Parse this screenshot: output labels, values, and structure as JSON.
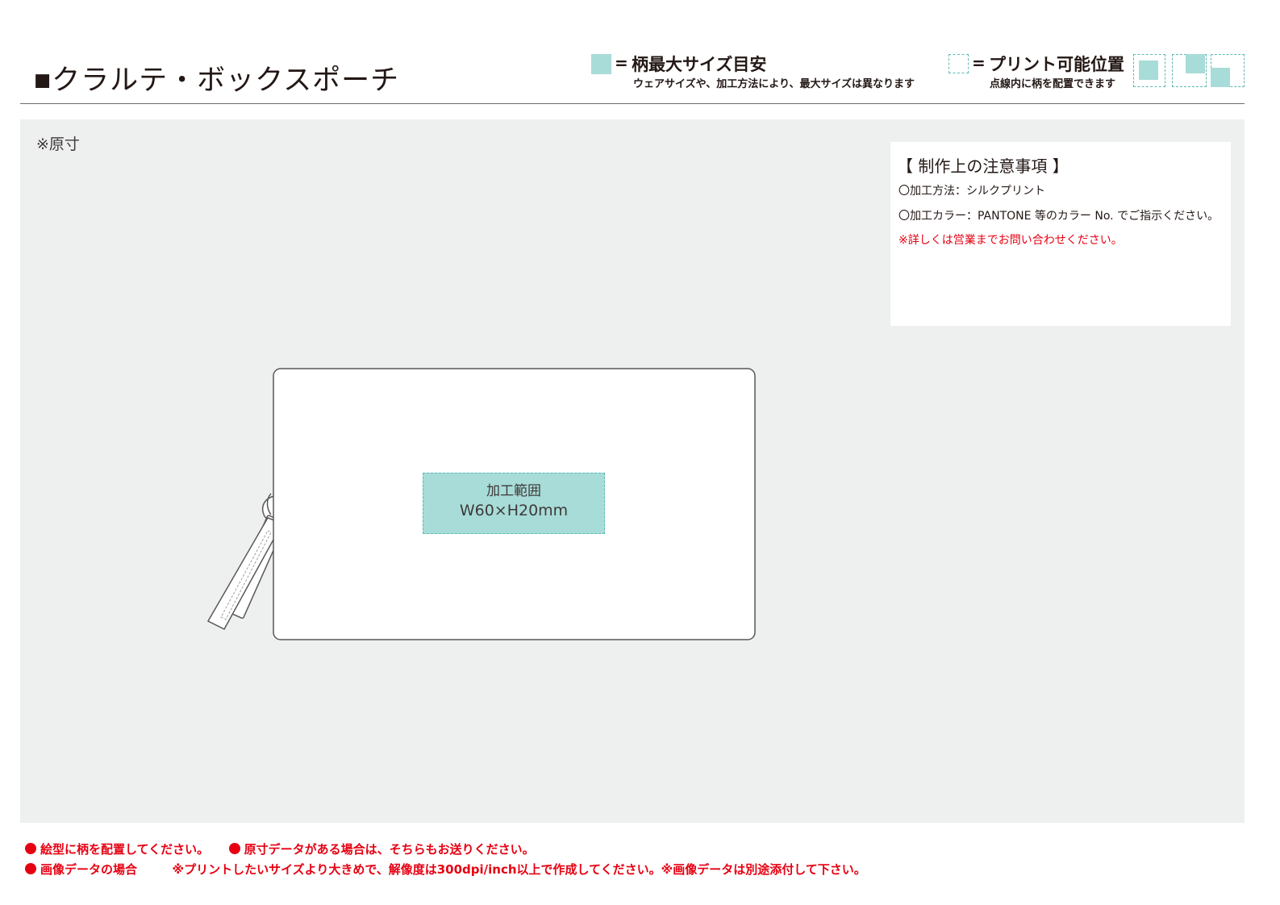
{
  "header": {
    "title": "■クラルテ・ボックスポーチ",
    "legend_max": {
      "eq": "=",
      "title": "柄最大サイズ目安",
      "sub": "ウェアサイズや、加工方法により、最大サイズは異なります"
    },
    "legend_print": {
      "eq": "=",
      "title": "プリント可能位置",
      "sub": "点線内に柄を配置できます"
    }
  },
  "work_area": {
    "scale_note": "※原寸",
    "print_area": {
      "label": "加工範囲",
      "size": "W60×H20mm"
    }
  },
  "notes": {
    "title": "【 制作上の注意事項 】",
    "method": "〇加工方法：シルクプリント",
    "color": "〇加工カラー：PANTONE 等のカラー No. でご指示ください。",
    "contact": "※詳しくは営業までお問い合わせください。"
  },
  "footer": {
    "item1": "絵型に柄を配置してください。",
    "item2": "原寸データがある場合は、そちらもお送りください。",
    "item3": "画像データの場合",
    "item3_detail": "※プリントしたいサイズより大きめで、解像度は300dpi/inch以上で作成してください。※画像データは別途添付して下さい。"
  },
  "colors": {
    "max_area_fill": "#a8dcd8",
    "dash_border": "#5fb8b3",
    "work_area_bg": "#eeefef",
    "accent_red": "#e60012"
  }
}
